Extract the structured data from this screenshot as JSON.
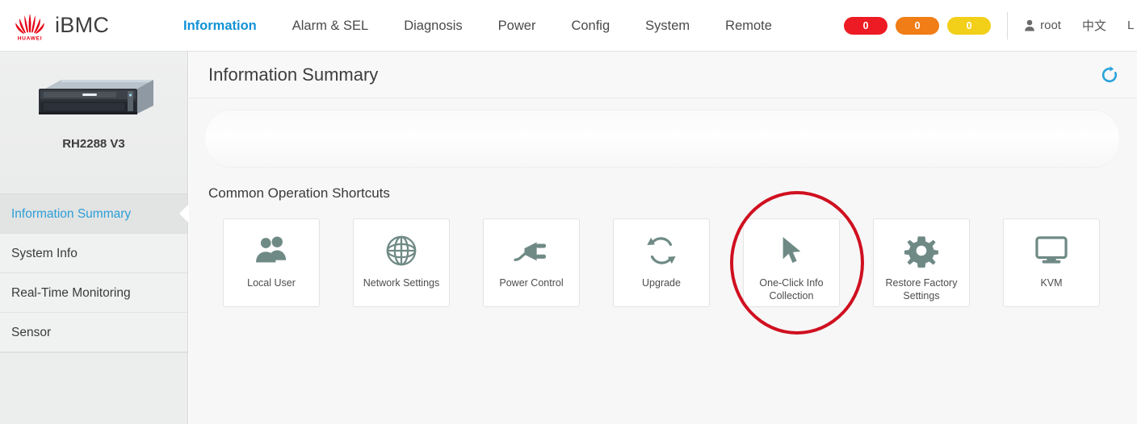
{
  "header": {
    "brand": "iBMC",
    "logo_icon": "huawei-flower-logo",
    "nav": [
      {
        "label": "Information",
        "active": true
      },
      {
        "label": "Alarm & SEL",
        "active": false
      },
      {
        "label": "Diagnosis",
        "active": false
      },
      {
        "label": "Power",
        "active": false
      },
      {
        "label": "Config",
        "active": false
      },
      {
        "label": "System",
        "active": false
      },
      {
        "label": "Remote",
        "active": false
      }
    ],
    "badges": [
      {
        "value": "0",
        "color": "#ed1c24",
        "name": "critical-alarm-badge"
      },
      {
        "value": "0",
        "color": "#f07d16",
        "name": "major-alarm-badge"
      },
      {
        "value": "0",
        "color": "#f2cf19",
        "name": "minor-alarm-badge"
      }
    ],
    "user": "root",
    "user_icon": "user-icon",
    "language": "中文",
    "logout": "L"
  },
  "sidebar": {
    "device_name": "RH2288 V3",
    "device_image": "rack-server-image",
    "items": [
      {
        "label": "Information Summary",
        "active": true
      },
      {
        "label": "System Info",
        "active": false
      },
      {
        "label": "Real-Time Monitoring",
        "active": false
      },
      {
        "label": "Sensor",
        "active": false
      }
    ]
  },
  "main": {
    "page_title": "Information Summary",
    "refresh_icon": "refresh-icon",
    "refresh_color": "#29a3dc",
    "section_title": "Common Operation Shortcuts",
    "shortcuts": [
      {
        "label": "Local User",
        "icon": "users-icon"
      },
      {
        "label": "Network Settings",
        "icon": "globe-icon"
      },
      {
        "label": "Power Control",
        "icon": "power-plug-icon"
      },
      {
        "label": "Upgrade",
        "icon": "refresh-arrows-icon"
      },
      {
        "label": "One-Click Info Collection",
        "icon": "cursor-arrow-icon",
        "highlighted": true
      },
      {
        "label": "Restore Factory Settings",
        "icon": "gear-icon"
      },
      {
        "label": "KVM",
        "icon": "monitor-icon"
      }
    ],
    "annotation": {
      "type": "circle",
      "color": "#cf1020",
      "target": "One-Click Info Collection"
    }
  }
}
